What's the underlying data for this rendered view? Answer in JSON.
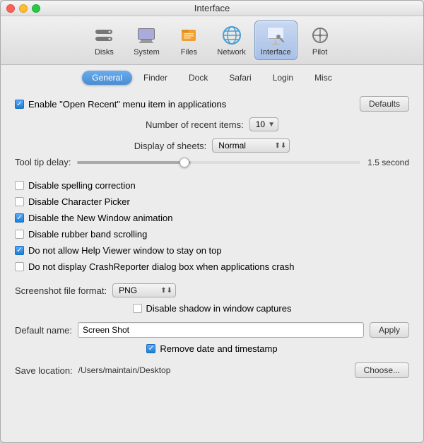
{
  "window": {
    "title": "Interface"
  },
  "toolbar": {
    "items": [
      {
        "id": "disks",
        "label": "Disks",
        "icon": "💾",
        "active": false
      },
      {
        "id": "system",
        "label": "System",
        "icon": "🖥",
        "active": false
      },
      {
        "id": "files",
        "label": "Files",
        "icon": "📁",
        "active": false
      },
      {
        "id": "network",
        "label": "Network",
        "icon": "🌐",
        "active": false
      },
      {
        "id": "interface",
        "label": "Interface",
        "icon": "🖱",
        "active": true
      },
      {
        "id": "pilot",
        "label": "Pilot",
        "icon": "✈️",
        "active": false
      }
    ]
  },
  "tabs": {
    "items": [
      {
        "id": "general",
        "label": "General",
        "active": true
      },
      {
        "id": "finder",
        "label": "Finder",
        "active": false
      },
      {
        "id": "dock",
        "label": "Dock",
        "active": false
      },
      {
        "id": "safari",
        "label": "Safari",
        "active": false
      },
      {
        "id": "login",
        "label": "Login",
        "active": false
      },
      {
        "id": "misc",
        "label": "Misc",
        "active": false
      }
    ]
  },
  "general": {
    "enable_open_recent_label": "Enable \"Open Recent\" menu item in applications",
    "enable_open_recent_checked": true,
    "defaults_button": "Defaults",
    "number_of_recent_label": "Number of recent items:",
    "number_of_recent_value": "10",
    "display_of_sheets_label": "Display of sheets:",
    "display_of_sheets_value": "Normal",
    "tool_tip_delay_label": "Tool tip delay:",
    "tool_tip_delay_value": "1.5 second",
    "checkboxes": [
      {
        "label": "Disable spelling correction",
        "checked": false
      },
      {
        "label": "Disable Character Picker",
        "checked": false
      },
      {
        "label": "Disable the New Window animation",
        "checked": true
      },
      {
        "label": "Disable rubber band scrolling",
        "checked": false
      },
      {
        "label": "Do not allow Help Viewer window to stay on top",
        "checked": true
      },
      {
        "label": "Do not display CrashReporter dialog box when applications crash",
        "checked": false
      }
    ],
    "screenshot_file_format_label": "Screenshot file format:",
    "screenshot_file_format_value": "PNG",
    "disable_shadow_label": "Disable shadow in window captures",
    "disable_shadow_checked": false,
    "default_name_label": "Default name:",
    "default_name_value": "Screen Shot",
    "apply_button": "Apply",
    "remove_date_label": "Remove date and timestamp",
    "remove_date_checked": true,
    "save_location_label": "Save location:",
    "save_location_value": "/Users/maintain/Desktop",
    "choose_button": "Choose..."
  }
}
